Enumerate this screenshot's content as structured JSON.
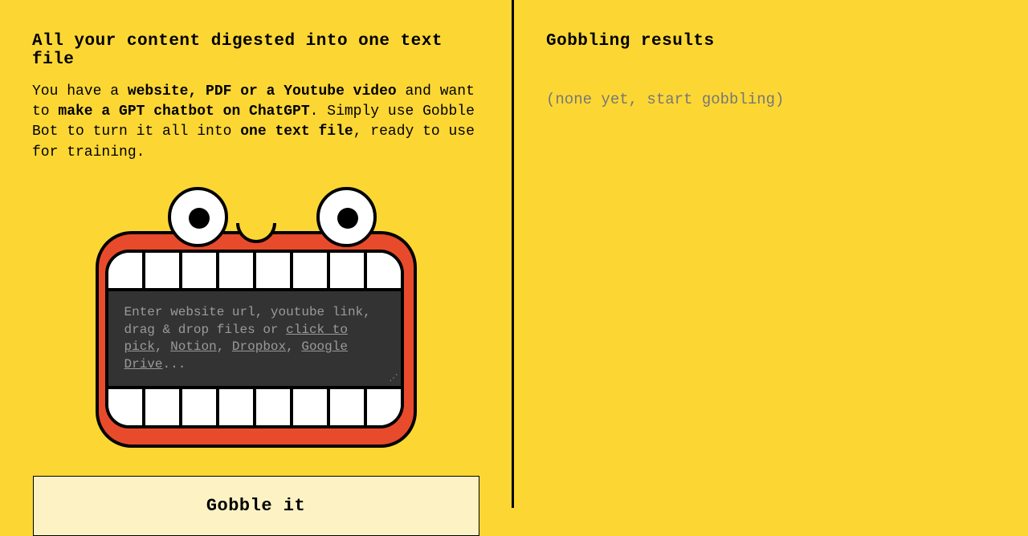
{
  "left": {
    "heading": "All your content digested into one text file",
    "desc_part1": "You have a ",
    "desc_bold1": "website, PDF or a Youtube video",
    "desc_part2": " and want to ",
    "desc_bold2": "make a GPT chatbot on ChatGPT",
    "desc_part3": ". Simply use Gobble Bot to turn it all into ",
    "desc_bold3": "one text file",
    "desc_part4": ", ready to use for training."
  },
  "input": {
    "prefix": "Enter website url, youtube link, drag & drop files or ",
    "link_click": "click to pick",
    "sep1": ", ",
    "link_notion": "Notion",
    "sep2": ", ",
    "link_dropbox": "Dropbox",
    "sep3": ", ",
    "link_gdrive": "Google Drive",
    "suffix": "..."
  },
  "button": {
    "label": "Gobble it"
  },
  "right": {
    "heading": "Gobbling results",
    "empty": "(none yet, start gobbling)"
  }
}
